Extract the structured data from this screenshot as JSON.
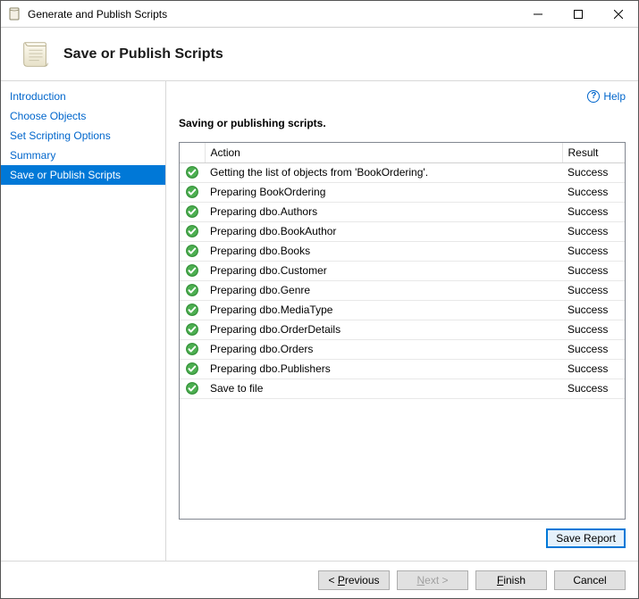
{
  "window": {
    "title": "Generate and Publish Scripts"
  },
  "header": {
    "title": "Save or Publish Scripts"
  },
  "help": {
    "label": "Help"
  },
  "sidebar": {
    "items": [
      {
        "label": "Introduction",
        "active": false
      },
      {
        "label": "Choose Objects",
        "active": false
      },
      {
        "label": "Set Scripting Options",
        "active": false
      },
      {
        "label": "Summary",
        "active": false
      },
      {
        "label": "Save or Publish Scripts",
        "active": true
      }
    ]
  },
  "main": {
    "section_title": "Saving or publishing scripts.",
    "columns": {
      "action": "Action",
      "result": "Result"
    },
    "rows": [
      {
        "action": "Getting the list of objects from 'BookOrdering'.",
        "result": "Success"
      },
      {
        "action": "Preparing BookOrdering",
        "result": "Success"
      },
      {
        "action": "Preparing dbo.Authors",
        "result": "Success"
      },
      {
        "action": "Preparing dbo.BookAuthor",
        "result": "Success"
      },
      {
        "action": "Preparing dbo.Books",
        "result": "Success"
      },
      {
        "action": "Preparing dbo.Customer",
        "result": "Success"
      },
      {
        "action": "Preparing dbo.Genre",
        "result": "Success"
      },
      {
        "action": "Preparing dbo.MediaType",
        "result": "Success"
      },
      {
        "action": "Preparing dbo.OrderDetails",
        "result": "Success"
      },
      {
        "action": "Preparing dbo.Orders",
        "result": "Success"
      },
      {
        "action": "Preparing dbo.Publishers",
        "result": "Success"
      },
      {
        "action": "Save to file",
        "result": "Success"
      }
    ],
    "save_report": "Save Report"
  },
  "footer": {
    "previous": "Previous",
    "next": "Next >",
    "finish": "Finish",
    "cancel": "Cancel"
  }
}
